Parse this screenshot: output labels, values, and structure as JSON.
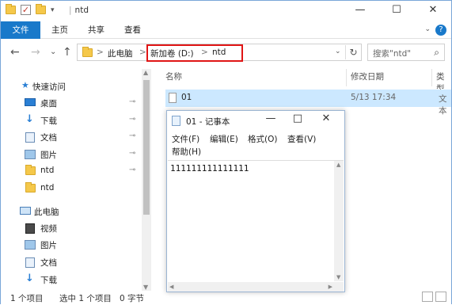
{
  "titlebar": {
    "title": "ntd",
    "minimize": "—",
    "maximize": "☐",
    "close": "✕",
    "qa_dropdown": "▾"
  },
  "ribbon": {
    "tabs": [
      "文件",
      "主页",
      "共享",
      "查看"
    ],
    "collapse": "⌄",
    "help": "?"
  },
  "nav": {
    "back": "←",
    "forward": "→",
    "recent": "⌄",
    "up": "↑",
    "breadcrumbs": [
      "此电脑",
      "新加卷 (D:)",
      "ntd"
    ],
    "separator": ">",
    "dropdown": "⌄",
    "refresh": "↻",
    "search_placeholder": "搜索\"ntd\"",
    "search_icon": "search-icon"
  },
  "sidebar": {
    "quick_access": "快速访问",
    "items": [
      {
        "label": "桌面",
        "pinned": true
      },
      {
        "label": "下载",
        "pinned": true
      },
      {
        "label": "文档",
        "pinned": true
      },
      {
        "label": "图片",
        "pinned": true
      },
      {
        "label": "ntd",
        "pinned": true
      },
      {
        "label": "ntd",
        "pinned": false
      }
    ],
    "this_pc": "此电脑",
    "pc_items": [
      "视频",
      "图片",
      "文档",
      "下载"
    ],
    "pin_glyph": "📌"
  },
  "content": {
    "columns": [
      "名称",
      "修改日期",
      "类型"
    ],
    "files": [
      {
        "name": "01",
        "modified": "5/13 17:34",
        "type": "文本"
      }
    ]
  },
  "status": {
    "count": "1 个项目",
    "selected": "选中 1 个项目",
    "size": "0 字节"
  },
  "notepad": {
    "title": "01 - 记事本",
    "minimize": "—",
    "maximize": "□",
    "close": "✕",
    "menu": [
      "文件(F)",
      "编辑(E)",
      "格式(O)",
      "查看(V)",
      "帮助(H)"
    ],
    "text": "111111111111111"
  },
  "colors": {
    "accent": "#1979ca",
    "highlight": "#e01515",
    "selection": "#cce8ff"
  }
}
